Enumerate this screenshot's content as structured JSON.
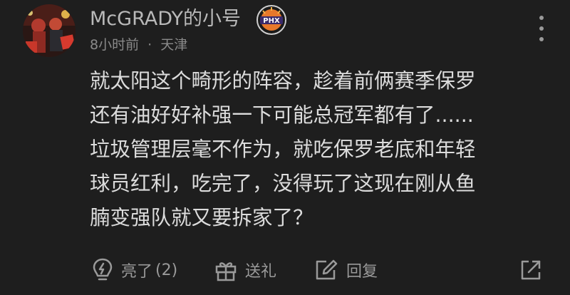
{
  "post": {
    "author": {
      "name": "McGRADY的小号",
      "badge_text": "PHX",
      "avatar_icon": "avatar-image"
    },
    "meta": {
      "time": "8小时前",
      "separator": "·",
      "location": "天津"
    },
    "content_lines": [
      "就太阳这个畸形的阵容，趁着前俩赛季保罗",
      "还有油好好补强一下可能总冠军都有了......",
      "垃圾管理层毫不作为，就吃保罗老底和年轻",
      "球员红利，吃完了，没得玩了这现在刚从鱼",
      "腩变强队就又要拆家了？"
    ]
  },
  "actions": {
    "like_label": "亮了",
    "like_count": "(2)",
    "gift_label": "送礼",
    "reply_label": "回复"
  },
  "colors": {
    "background": "#1e1e1e",
    "text": "#dcdcdc",
    "muted": "#8a8a8a",
    "badge_orange": "#e7782b"
  },
  "icons": [
    "more-vertical-icon",
    "lightbulb-icon",
    "gift-icon",
    "edit-reply-icon",
    "share-icon"
  ]
}
